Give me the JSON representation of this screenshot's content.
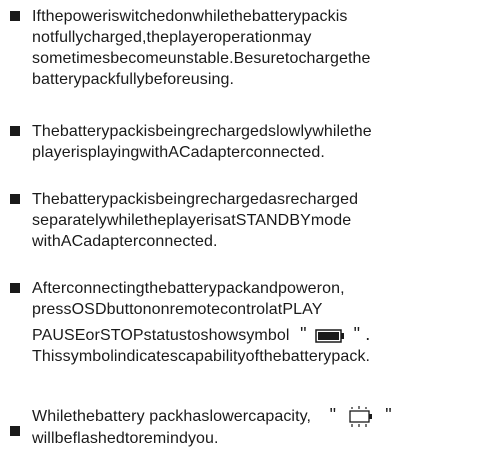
{
  "items": [
    {
      "lines": [
        "Ifthepoweriswitchedonwhilethebatterypackis",
        "notfullycharged,theplayeroperationmay",
        "sometimesbecomeunstable.Besuretochargethe",
        "batterypackfullybeforeusing."
      ]
    },
    {
      "lines": [
        "Thebatterypackisbeingrechargedslowlywhilethe",
        "playerisplayingwithACadapterconnected."
      ]
    },
    {
      "lines": [
        "Thebatterypackisbeingrechargedasrecharged",
        "separatelywhiletheplayerisatSTANDBYmode",
        "withACadapterconnected."
      ]
    },
    {
      "lines": [
        "Afterconnectingthebatterypackandpoweron,",
        "pressOSDbuttononremotecontrolatPLAY",
        "PAUSEorSTOPstatustoshowsymbol",
        "Thissymbolindicatescapabilityofthebatterypack."
      ],
      "symbol_open": "\"",
      "symbol_close": "\" .",
      "symbol_icon": "battery-full-icon"
    },
    {
      "lines": [
        "Whilethebattery packhaslowercapacity,",
        "willbeflashedtoremindyou."
      ],
      "symbol_open": "\"",
      "symbol_close": "\"",
      "symbol_icon": "battery-empty-flashing-icon"
    }
  ]
}
